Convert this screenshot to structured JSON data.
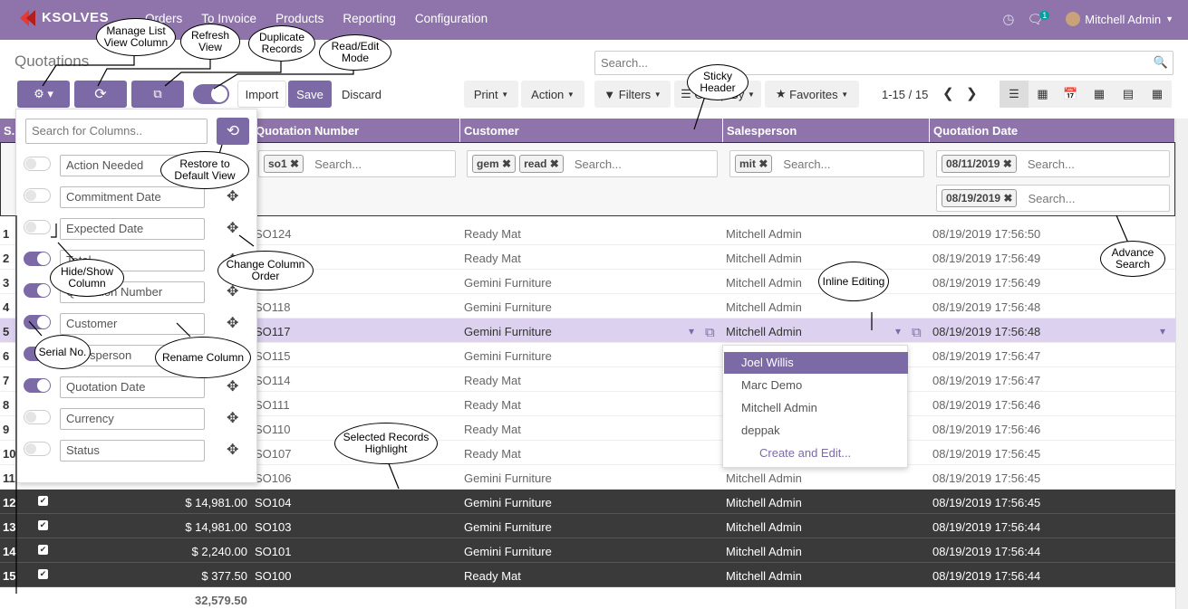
{
  "nav": {
    "brand": "KSOLVES",
    "menu": [
      "Orders",
      "To Invoice",
      "Products",
      "Reporting",
      "Configuration"
    ],
    "badge": "1",
    "user": "Mitchell Admin"
  },
  "crumb": "Quotations",
  "search_placeholder": "Search...",
  "toolbar": {
    "import": "Import",
    "save": "Save",
    "discard": "Discard",
    "print": "Print",
    "action": "Action",
    "filters": "Filters",
    "groupby": "Group By",
    "favorites": "Favorites",
    "pager": "1-15 / 15"
  },
  "columns": {
    "sn": "S.",
    "qn": "Quotation Number",
    "cust": "Customer",
    "sales": "Salesperson",
    "date": "Quotation Date"
  },
  "filters": {
    "qn": [
      "so1"
    ],
    "cust": [
      "gem",
      "read"
    ],
    "sales": [
      "mit"
    ],
    "date": [
      "08/11/2019",
      "08/19/2019"
    ],
    "placeholder": "Search..."
  },
  "panel": {
    "search_placeholder": "Search for Columns..",
    "items": [
      "Action Needed",
      "Commitment Date",
      "Expected Date",
      "Total",
      "Quotation Number",
      "Customer",
      "Salesperson",
      "Quotation Date",
      "Currency",
      "Status"
    ]
  },
  "rows": [
    {
      "n": "1",
      "amt": "",
      "qn": "SO124",
      "cust": "Ready Mat",
      "sales": "Mitchell Admin",
      "date": "08/19/2019 17:56:50"
    },
    {
      "n": "2",
      "amt": "",
      "qn": "",
      "cust": "Ready Mat",
      "sales": "Mitchell Admin",
      "date": "08/19/2019 17:56:49"
    },
    {
      "n": "3",
      "amt": "",
      "qn": "",
      "cust": "Gemini Furniture",
      "sales": "Mitchell Admin",
      "date": "08/19/2019 17:56:49"
    },
    {
      "n": "4",
      "amt": "",
      "qn": "SO118",
      "cust": "Gemini Furniture",
      "sales": "Mitchell Admin",
      "date": "08/19/2019 17:56:48"
    },
    {
      "n": "5",
      "amt": "",
      "qn": "SO117",
      "cust": "Gemini Furniture",
      "sales": "Mitchell Admin",
      "date": "08/19/2019 17:56:48"
    },
    {
      "n": "6",
      "amt": "",
      "qn": "SO115",
      "cust": "Gemini Furniture",
      "sales": "",
      "date": "08/19/2019 17:56:47"
    },
    {
      "n": "7",
      "amt": "",
      "qn": "SO114",
      "cust": "Ready Mat",
      "sales": "",
      "date": "08/19/2019 17:56:47"
    },
    {
      "n": "8",
      "amt": "",
      "qn": "SO111",
      "cust": "Ready Mat",
      "sales": "",
      "date": "08/19/2019 17:56:46"
    },
    {
      "n": "9",
      "amt": "",
      "qn": "SO110",
      "cust": "Ready Mat",
      "sales": "",
      "date": "08/19/2019 17:56:46"
    },
    {
      "n": "10",
      "amt": "",
      "qn": "SO107",
      "cust": "Ready Mat",
      "sales": "",
      "date": "08/19/2019 17:56:45"
    },
    {
      "n": "11",
      "amt": "",
      "qn": "SO106",
      "cust": "Gemini Furniture",
      "sales": "Mitchell Admin",
      "date": "08/19/2019 17:56:45"
    },
    {
      "n": "12",
      "amt": "$ 14,981.00",
      "qn": "SO104",
      "cust": "Gemini Furniture",
      "sales": "Mitchell Admin",
      "date": "08/19/2019 17:56:45"
    },
    {
      "n": "13",
      "amt": "$ 14,981.00",
      "qn": "SO103",
      "cust": "Gemini Furniture",
      "sales": "Mitchell Admin",
      "date": "08/19/2019 17:56:44"
    },
    {
      "n": "14",
      "amt": "$ 2,240.00",
      "qn": "SO101",
      "cust": "Gemini Furniture",
      "sales": "Mitchell Admin",
      "date": "08/19/2019 17:56:44"
    },
    {
      "n": "15",
      "amt": "$ 377.50",
      "qn": "SO100",
      "cust": "Ready Mat",
      "sales": "Mitchell Admin",
      "date": "08/19/2019 17:56:44"
    }
  ],
  "total": "32,579.50",
  "dropdown": [
    "Joel Willis",
    "Marc Demo",
    "Mitchell Admin",
    "deppak",
    "Create and Edit..."
  ],
  "bubbles": {
    "manage": "Manage List View Column",
    "refresh": "Refresh View",
    "dup": "Duplicate Records",
    "rw": "Read/Edit Mode",
    "sticky": "Sticky Header",
    "restore": "Restore to Default View",
    "hide": "Hide/Show Column",
    "change": "Change Column Order",
    "serial": "Serial No.",
    "rename": "Rename Column",
    "inline": "Inline Editing",
    "advance": "Advance Search",
    "selected": "Selected Records Highlight"
  }
}
